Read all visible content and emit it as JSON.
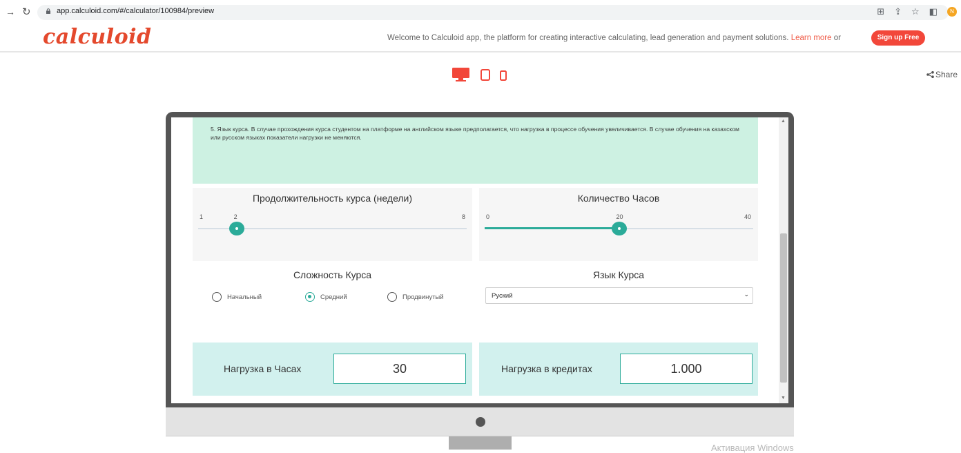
{
  "browser": {
    "url": "app.calculoid.com/#/calculator/100984/preview",
    "profile_initial": "N"
  },
  "header": {
    "logo": "calculoid",
    "welcome_text": "Welcome to Calculoid app, the platform for creating interactive calculating, lead generation and payment solutions.",
    "learn_more": "Learn more",
    "or_text": "or",
    "signup_label": "Sign up Free",
    "share_label": "Share"
  },
  "calculator": {
    "info_text": "5. Язык курса. В случае прохождения курса студентом на платформе на английском языке предполагается, что нагрузка в процессе обучения увеличивается. В случае обучения на казахском или русском языках показатели нагрузки не меняются.",
    "duration": {
      "title": "Продолжительность курса (недели)",
      "min": "1",
      "value": "2",
      "max": "8",
      "fraction": 0.143
    },
    "hours": {
      "title": "Количество Часов",
      "min": "0",
      "value": "20",
      "max": "40",
      "fraction": 0.5
    },
    "difficulty": {
      "title": "Сложность Курса",
      "options": [
        "Начальный",
        "Средний",
        "Продвинутый"
      ],
      "selected": "Средний"
    },
    "language": {
      "title": "Язык Курса",
      "selected": "Руский"
    },
    "results": {
      "hours_label": "Нагрузка в Часах",
      "hours_value": "30",
      "credits_label": "Нагрузка в кредитах",
      "credits_value": "1.000"
    }
  },
  "watermark": "Активация Windows",
  "colors": {
    "brand": "#e4492d",
    "accent": "#2bab99",
    "info_bg": "#cdf1e2",
    "result_bg": "#d2f1ee"
  }
}
